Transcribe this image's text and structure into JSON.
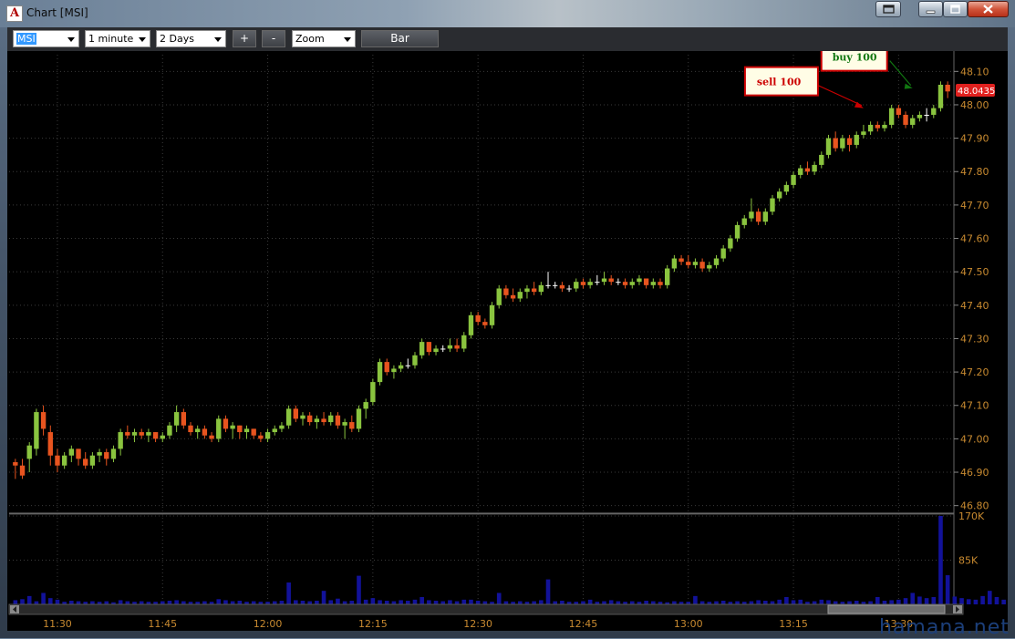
{
  "window": {
    "title": "Chart [MSI]"
  },
  "toolbar": {
    "symbol": "MSI",
    "interval": "1 minute",
    "range": "2 Days",
    "zoom_in": "+",
    "zoom_out": "-",
    "mode": "Zoom",
    "type_button": "Bar"
  },
  "watermark": "hamana.net",
  "chart_data": {
    "type": "candlestick",
    "price_axis": {
      "ticks": [
        "48.10",
        "48.00",
        "47.90",
        "47.80",
        "47.70",
        "47.60",
        "47.50",
        "47.40",
        "47.30",
        "47.20",
        "47.10",
        "47.00",
        "46.90",
        "46.80"
      ],
      "range": [
        46.78,
        48.15
      ]
    },
    "volume_axis": {
      "ticks": [
        "170K",
        "85K"
      ],
      "range": [
        0,
        170000
      ]
    },
    "time_axis": {
      "ticks": [
        "11:30",
        "11:45",
        "12:00",
        "12:15",
        "12:30",
        "12:45",
        "13:00",
        "13:15",
        "13:30"
      ]
    },
    "last_price": "48.0435",
    "annotations": [
      {
        "label": "sell 100",
        "price": 47.99,
        "time_index": 121
      },
      {
        "label": "buy 100",
        "price": 48.05,
        "time_index": 128
      }
    ],
    "colors": {
      "up": "#8ac43f",
      "down": "#e8541f",
      "doji": "#ffffff",
      "volume": "#12129a",
      "price_label": "#e0201e",
      "axis_text": "#c88a30",
      "grid": "#3a3a3a",
      "sell": "#cc0000",
      "buy": "#117711"
    },
    "candles": [
      [
        46.93,
        46.94,
        46.88,
        46.92
      ],
      [
        46.92,
        46.94,
        46.88,
        46.89
      ],
      [
        46.94,
        46.99,
        46.9,
        46.98
      ],
      [
        46.97,
        47.09,
        46.95,
        47.08
      ],
      [
        47.08,
        47.1,
        47.01,
        47.03
      ],
      [
        47.02,
        47.04,
        46.92,
        46.95
      ],
      [
        46.95,
        46.97,
        46.9,
        46.92
      ],
      [
        46.92,
        46.96,
        46.91,
        46.95
      ],
      [
        46.95,
        46.98,
        46.93,
        46.97
      ],
      [
        46.97,
        46.97,
        46.92,
        46.94
      ],
      [
        46.94,
        46.96,
        46.91,
        46.92
      ],
      [
        46.92,
        46.96,
        46.91,
        46.95
      ],
      [
        46.95,
        46.97,
        46.93,
        46.96
      ],
      [
        46.96,
        46.97,
        46.92,
        46.94
      ],
      [
        46.94,
        46.98,
        46.93,
        46.97
      ],
      [
        46.97,
        47.03,
        46.95,
        47.02
      ],
      [
        47.02,
        47.04,
        47.0,
        47.01
      ],
      [
        47.01,
        47.03,
        46.99,
        47.02
      ],
      [
        47.02,
        47.03,
        47.0,
        47.01
      ],
      [
        47.01,
        47.03,
        46.99,
        47.02
      ],
      [
        47.02,
        47.02,
        46.99,
        47.0
      ],
      [
        47.0,
        47.02,
        46.99,
        47.01
      ],
      [
        47.01,
        47.05,
        47.0,
        47.04
      ],
      [
        47.04,
        47.1,
        47.02,
        47.08
      ],
      [
        47.08,
        47.09,
        47.03,
        47.04
      ],
      [
        47.04,
        47.05,
        47.01,
        47.02
      ],
      [
        47.02,
        47.04,
        47.0,
        47.03
      ],
      [
        47.03,
        47.04,
        47.0,
        47.01
      ],
      [
        47.01,
        47.02,
        46.99,
        47.0
      ],
      [
        47.0,
        47.07,
        46.99,
        47.06
      ],
      [
        47.06,
        47.07,
        47.02,
        47.03
      ],
      [
        47.03,
        47.05,
        47.0,
        47.04
      ],
      [
        47.04,
        47.04,
        47.0,
        47.02
      ],
      [
        47.02,
        47.04,
        47.0,
        47.03
      ],
      [
        47.03,
        47.03,
        47.0,
        47.01
      ],
      [
        47.01,
        47.02,
        46.99,
        47.0
      ],
      [
        47.0,
        47.03,
        46.99,
        47.02
      ],
      [
        47.02,
        47.04,
        47.01,
        47.03
      ],
      [
        47.03,
        47.05,
        47.02,
        47.04
      ],
      [
        47.04,
        47.1,
        47.03,
        47.09
      ],
      [
        47.09,
        47.1,
        47.05,
        47.06
      ],
      [
        47.06,
        47.08,
        47.04,
        47.07
      ],
      [
        47.07,
        47.08,
        47.04,
        47.05
      ],
      [
        47.05,
        47.07,
        47.03,
        47.06
      ],
      [
        47.06,
        47.08,
        47.04,
        47.05
      ],
      [
        47.05,
        47.08,
        47.04,
        47.07
      ],
      [
        47.07,
        47.08,
        47.03,
        47.04
      ],
      [
        47.04,
        47.06,
        47.0,
        47.05
      ],
      [
        47.05,
        47.07,
        47.02,
        47.03
      ],
      [
        47.03,
        47.1,
        47.02,
        47.09
      ],
      [
        47.09,
        47.12,
        47.06,
        47.11
      ],
      [
        47.11,
        47.18,
        47.1,
        47.17
      ],
      [
        47.17,
        47.24,
        47.16,
        47.23
      ],
      [
        47.23,
        47.24,
        47.19,
        47.2
      ],
      [
        47.2,
        47.22,
        47.18,
        47.21
      ],
      [
        47.21,
        47.23,
        47.2,
        47.22
      ],
      [
        47.22,
        47.24,
        47.21,
        47.22
      ],
      [
        47.22,
        47.26,
        47.21,
        47.25
      ],
      [
        47.25,
        47.3,
        47.24,
        47.29
      ],
      [
        47.29,
        47.29,
        47.25,
        47.26
      ],
      [
        47.26,
        47.28,
        47.25,
        47.27
      ],
      [
        47.27,
        47.28,
        47.26,
        47.27
      ],
      [
        47.27,
        47.3,
        47.26,
        47.28
      ],
      [
        47.28,
        47.3,
        47.26,
        47.27
      ],
      [
        47.27,
        47.32,
        47.26,
        47.31
      ],
      [
        47.31,
        47.38,
        47.3,
        47.37
      ],
      [
        47.37,
        47.38,
        47.34,
        47.35
      ],
      [
        47.35,
        47.36,
        47.33,
        47.34
      ],
      [
        47.34,
        47.41,
        47.33,
        47.4
      ],
      [
        47.4,
        47.46,
        47.39,
        47.45
      ],
      [
        47.45,
        47.46,
        47.42,
        47.43
      ],
      [
        47.43,
        47.45,
        47.41,
        47.42
      ],
      [
        47.42,
        47.45,
        47.41,
        47.44
      ],
      [
        47.44,
        47.46,
        47.42,
        47.45
      ],
      [
        47.45,
        47.47,
        47.43,
        47.44
      ],
      [
        47.44,
        47.47,
        47.43,
        47.46
      ],
      [
        47.46,
        47.5,
        47.45,
        47.46
      ],
      [
        47.46,
        47.47,
        47.45,
        47.46
      ],
      [
        47.46,
        47.47,
        47.44,
        47.45
      ],
      [
        47.45,
        47.46,
        47.44,
        47.45
      ],
      [
        47.45,
        47.48,
        47.44,
        47.47
      ],
      [
        47.47,
        47.48,
        47.45,
        47.46
      ],
      [
        47.46,
        47.48,
        47.45,
        47.47
      ],
      [
        47.47,
        47.49,
        47.46,
        47.47
      ],
      [
        47.47,
        47.5,
        47.46,
        47.48
      ],
      [
        47.48,
        47.49,
        47.46,
        47.47
      ],
      [
        47.47,
        47.48,
        47.46,
        47.47
      ],
      [
        47.47,
        47.48,
        47.45,
        47.46
      ],
      [
        47.46,
        47.48,
        47.45,
        47.47
      ],
      [
        47.47,
        47.49,
        47.46,
        47.48
      ],
      [
        47.48,
        47.48,
        47.45,
        47.46
      ],
      [
        47.46,
        47.48,
        47.45,
        47.47
      ],
      [
        47.47,
        47.48,
        47.45,
        47.46
      ],
      [
        47.46,
        47.52,
        47.45,
        47.51
      ],
      [
        47.51,
        47.55,
        47.5,
        47.54
      ],
      [
        47.54,
        47.55,
        47.52,
        47.53
      ],
      [
        47.53,
        47.55,
        47.51,
        47.52
      ],
      [
        47.52,
        47.54,
        47.51,
        47.53
      ],
      [
        47.53,
        47.54,
        47.5,
        47.51
      ],
      [
        47.51,
        47.53,
        47.5,
        47.52
      ],
      [
        47.52,
        47.55,
        47.51,
        47.54
      ],
      [
        47.54,
        47.58,
        47.53,
        47.57
      ],
      [
        47.57,
        47.61,
        47.56,
        47.6
      ],
      [
        47.6,
        47.65,
        47.59,
        47.64
      ],
      [
        47.64,
        47.67,
        47.63,
        47.66
      ],
      [
        47.66,
        47.72,
        47.65,
        47.68
      ],
      [
        47.68,
        47.69,
        47.64,
        47.65
      ],
      [
        47.65,
        47.69,
        47.64,
        47.68
      ],
      [
        47.68,
        47.73,
        47.67,
        47.72
      ],
      [
        47.72,
        47.75,
        47.71,
        47.74
      ],
      [
        47.74,
        47.77,
        47.73,
        47.76
      ],
      [
        47.76,
        47.8,
        47.75,
        47.79
      ],
      [
        47.79,
        47.82,
        47.78,
        47.81
      ],
      [
        47.81,
        47.83,
        47.79,
        47.8
      ],
      [
        47.8,
        47.83,
        47.79,
        47.82
      ],
      [
        47.82,
        47.86,
        47.81,
        47.85
      ],
      [
        47.85,
        47.91,
        47.84,
        47.9
      ],
      [
        47.9,
        47.92,
        47.86,
        47.87
      ],
      [
        47.87,
        47.91,
        47.86,
        47.9
      ],
      [
        47.9,
        47.91,
        47.86,
        47.88
      ],
      [
        47.88,
        47.92,
        47.87,
        47.91
      ],
      [
        47.91,
        47.94,
        47.9,
        47.92
      ],
      [
        47.92,
        47.95,
        47.91,
        47.94
      ],
      [
        47.94,
        47.95,
        47.92,
        47.93
      ],
      [
        47.93,
        47.95,
        47.92,
        47.94
      ],
      [
        47.94,
        48.0,
        47.93,
        47.99
      ],
      [
        47.99,
        48.0,
        47.96,
        47.97
      ],
      [
        47.97,
        47.98,
        47.93,
        47.94
      ],
      [
        47.94,
        47.97,
        47.93,
        47.96
      ],
      [
        47.96,
        47.98,
        47.95,
        47.97
      ],
      [
        47.97,
        47.99,
        47.95,
        47.97
      ],
      [
        47.97,
        48.0,
        47.96,
        47.99
      ],
      [
        47.99,
        48.07,
        47.98,
        48.06
      ],
      [
        48.06,
        48.07,
        48.02,
        48.04
      ]
    ],
    "volumes": [
      8000,
      10000,
      16000,
      6000,
      22000,
      12000,
      9000,
      5000,
      7000,
      6000,
      5000,
      6000,
      5000,
      6000,
      4000,
      8000,
      6000,
      5000,
      6000,
      5000,
      5000,
      6000,
      7000,
      8000,
      6000,
      5000,
      5000,
      6000,
      5000,
      10000,
      8000,
      6000,
      7000,
      5000,
      6000,
      5000,
      5000,
      6000,
      7000,
      42000,
      8000,
      7000,
      6000,
      7000,
      26000,
      8000,
      11000,
      6000,
      7000,
      55000,
      9000,
      12000,
      8000,
      7000,
      6000,
      8000,
      7000,
      9000,
      14000,
      8000,
      7000,
      6000,
      8000,
      6000,
      9000,
      9000,
      7000,
      6000,
      5000,
      22000,
      6000,
      5000,
      6000,
      5000,
      6000,
      8000,
      48000,
      6000,
      7000,
      5000,
      5000,
      6000,
      9000,
      5000,
      6000,
      8000,
      6000,
      5000,
      6000,
      5000,
      7000,
      6000,
      5000,
      4000,
      6000,
      5000,
      5000,
      16000,
      6000,
      5000,
      6000,
      7000,
      5000,
      6000,
      5000,
      6000,
      8000,
      7000,
      6000,
      9000,
      14000,
      8000,
      9000,
      5000,
      6000,
      9000,
      8000,
      6000,
      5000,
      6000,
      7000,
      5000,
      6000,
      14000,
      7000,
      8000,
      9000,
      12000,
      22000,
      15000,
      12000,
      14000,
      170000,
      56000,
      15000,
      12000,
      10000,
      9000,
      16000,
      26000,
      14000,
      9000,
      12000,
      18000,
      10000,
      8000
    ]
  }
}
